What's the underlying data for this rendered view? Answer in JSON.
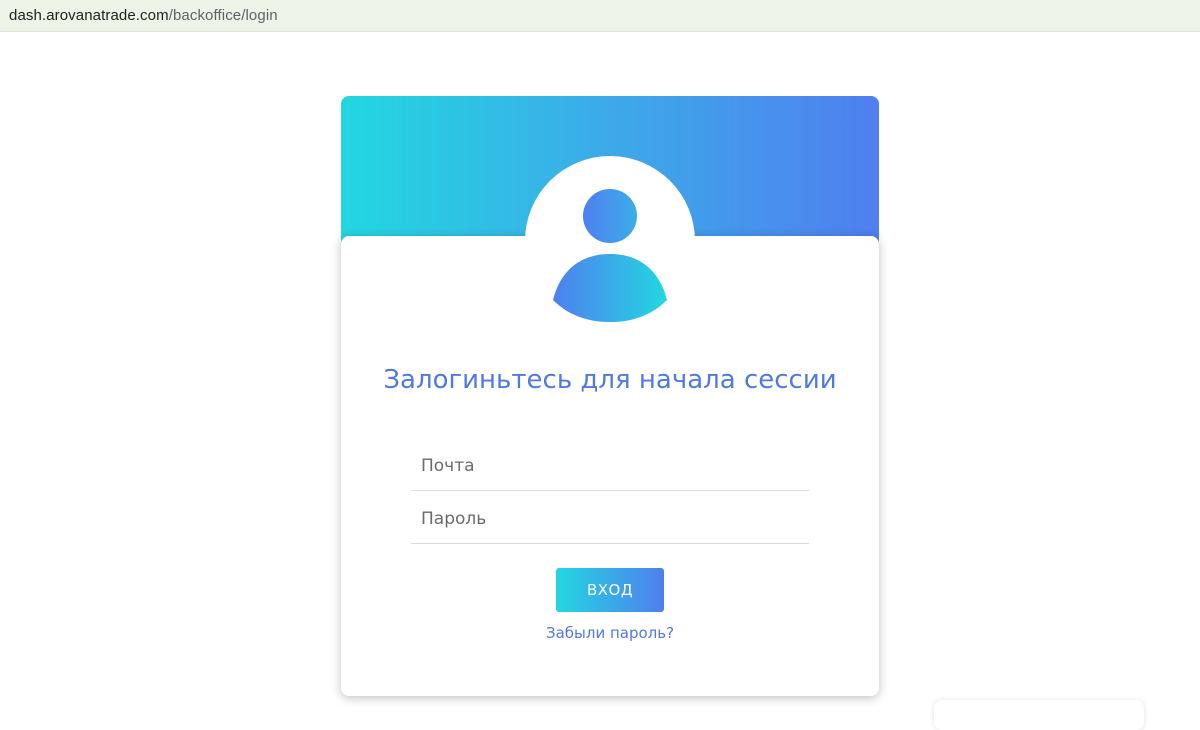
{
  "browser": {
    "url_host": "dash.arovanatrade.com",
    "url_path": "/backoffice/login"
  },
  "login": {
    "title": "Залогиньтесь для начала сессии",
    "email_placeholder": "Почта",
    "password_placeholder": "Пароль",
    "submit_label": "ВХОД",
    "forgot_label": "Забыли пароль?"
  },
  "colors": {
    "gradient_start": "#22d7e0",
    "gradient_end": "#4f7fef",
    "accent_text": "#5279e3"
  },
  "icons": {
    "avatar": "user-avatar-icon"
  }
}
